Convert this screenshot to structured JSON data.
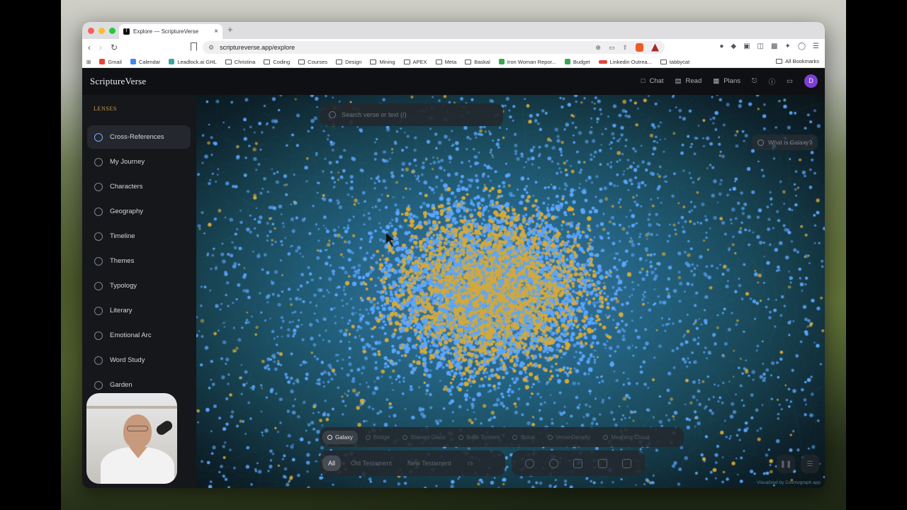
{
  "browser": {
    "tab_title": "Explore — ScriptureVerse",
    "tab_favicon": "T",
    "tab_close": "×",
    "new_tab": "+",
    "url": "scriptureverse.app/explore",
    "bookmarks": [
      {
        "label": "Gmail",
        "icon": "gmail-icon"
      },
      {
        "label": "Calendar",
        "icon": "calendar-icon"
      },
      {
        "label": "Leadlock.ai GHL",
        "icon": "leadlock-icon"
      },
      {
        "label": "Christina",
        "icon": "folder-icon"
      },
      {
        "label": "Coding",
        "icon": "folder-icon"
      },
      {
        "label": "Courses",
        "icon": "folder-icon"
      },
      {
        "label": "Design",
        "icon": "folder-icon"
      },
      {
        "label": "Mining",
        "icon": "folder-icon"
      },
      {
        "label": "APEX",
        "icon": "folder-icon"
      },
      {
        "label": "Meta",
        "icon": "folder-icon"
      },
      {
        "label": "Baskal",
        "icon": "folder-icon"
      },
      {
        "label": "Iron Woman Repor...",
        "icon": "sheets-icon"
      },
      {
        "label": "Budget",
        "icon": "sheets-icon"
      },
      {
        "label": "Linkedin Outrea...",
        "icon": "linkedin-icon"
      },
      {
        "label": "tabbycat",
        "icon": "folder-icon"
      }
    ],
    "all_bookmarks": "All Bookmarks"
  },
  "app": {
    "brand": "ScriptureVerse",
    "nav": {
      "chat": "Chat",
      "read": "Read",
      "plans": "Plans",
      "avatar": "D"
    },
    "sidebar": {
      "heading": "LENSES",
      "items": [
        {
          "label": "Cross-References",
          "active": true
        },
        {
          "label": "My Journey"
        },
        {
          "label": "Characters"
        },
        {
          "label": "Geography"
        },
        {
          "label": "Timeline"
        },
        {
          "label": "Themes"
        },
        {
          "label": "Typology"
        },
        {
          "label": "Literary"
        },
        {
          "label": "Emotional Arc"
        },
        {
          "label": "Word Study"
        },
        {
          "label": "Garden"
        }
      ]
    },
    "search": {
      "placeholder": "Search verse or text (/)"
    },
    "what_is": "What is Galaxy?",
    "modes": [
      "Galaxy",
      "Bridge",
      "Stained Glass",
      "Solar System",
      "Spiral",
      "Verse Density",
      "Meaning Cloud"
    ],
    "filters": {
      "all": "All",
      "old": "Old Testament",
      "new": "New Testament",
      "count": "73"
    },
    "credit": "Visualized by Cosmograph.app",
    "colors": {
      "node_blue": "#5aa6ff",
      "node_gold": "#d3a93c",
      "accent_gold": "#c9a04b",
      "avatar": "#7e3fd6"
    }
  }
}
